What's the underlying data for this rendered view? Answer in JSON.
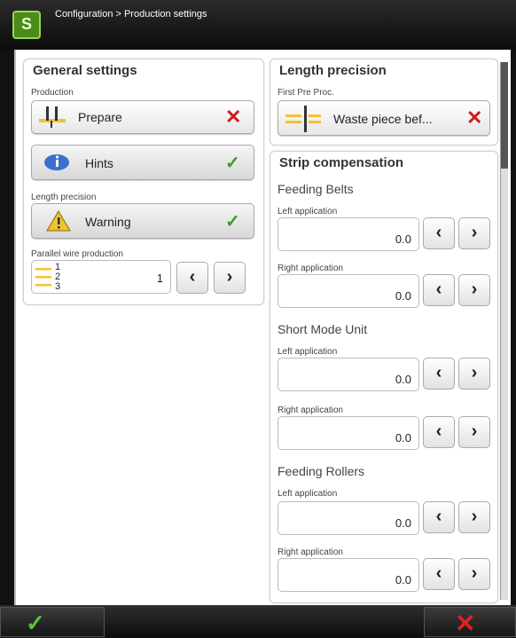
{
  "header": {
    "logo_text": "S",
    "breadcrumb": "Configuration > Production settings"
  },
  "general": {
    "title": "General settings",
    "production_label": "Production",
    "production_value": "Prepare",
    "hints_value": "Hints",
    "length_precision_label": "Length precision",
    "length_precision_value": "Warning",
    "parallel_label": "Parallel wire production",
    "parallel_lines": [
      "1",
      "2",
      "3"
    ],
    "parallel_value": "1"
  },
  "length_precision": {
    "title": "Length precision",
    "first_pre_label": "First Pre Proc.",
    "first_pre_value": "Waste piece bef..."
  },
  "strip": {
    "title": "Strip compensation",
    "groups": [
      {
        "name": "Feeding Belts",
        "left_label": "Left application",
        "left_value": "0.0",
        "right_label": "Right application",
        "right_value": "0.0"
      },
      {
        "name": "Short Mode Unit",
        "left_label": "Left application",
        "left_value": "0.0",
        "right_label": "Right application",
        "right_value": "0.0"
      },
      {
        "name": "Feeding Rollers",
        "left_label": "Left application",
        "left_value": "0.0",
        "right_label": "Right application",
        "right_value": "0.0"
      }
    ]
  },
  "icons": {
    "ok": "checkmark-icon",
    "cancel": "cross-icon",
    "left": "chevron-left-icon",
    "right": "chevron-right-icon",
    "hint": "info-bubble-icon",
    "warning": "warning-icon"
  },
  "colors": {
    "ok": "#3a9a2a",
    "cancel": "#d01a1a",
    "accent": "#f2c230"
  }
}
